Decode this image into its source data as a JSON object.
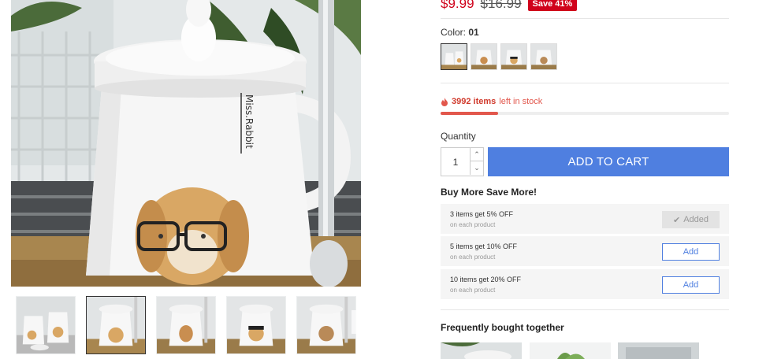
{
  "price": {
    "current": "$9.99",
    "original": "$16.99",
    "save_badge": "Save 41%"
  },
  "color": {
    "label": "Color:",
    "selected": "01",
    "swatch_count": 4,
    "selected_index": 0
  },
  "stock": {
    "count_text": "3992 items",
    "suffix": "left in stock",
    "level_percent": 20,
    "icon": "fire-icon",
    "color": "#e2574c"
  },
  "quantity": {
    "label": "Quantity",
    "value": "1"
  },
  "add_to_cart": {
    "label": "ADD TO CART",
    "color": "#4f7fe0"
  },
  "bulk": {
    "title": "Buy More Save More!",
    "offers": [
      {
        "title": "3 items get 5% OFF",
        "sub": "on each product",
        "button": "Added",
        "state": "added"
      },
      {
        "title": "5 items get 10% OFF",
        "sub": "on each product",
        "button": "Add",
        "state": "available"
      },
      {
        "title": "10 items get 20% OFF",
        "sub": "on each product",
        "button": "Add",
        "state": "available"
      }
    ]
  },
  "fbt": {
    "title": "Frequently bought together"
  },
  "brand_text": "Miss.Rabbit",
  "accent": "#d0021b"
}
